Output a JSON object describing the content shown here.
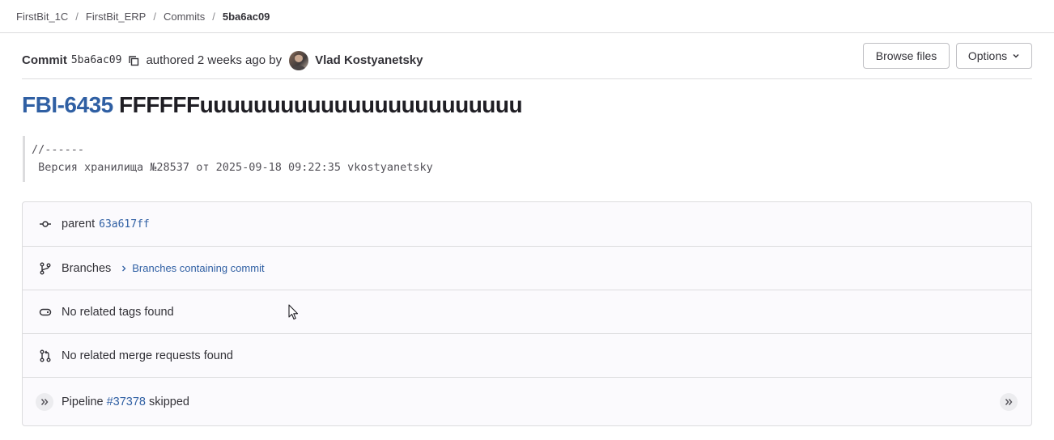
{
  "breadcrumb": {
    "items": [
      "FirstBit_1C",
      "FirstBit_ERP",
      "Commits",
      "5ba6ac09"
    ],
    "separator": "/"
  },
  "header": {
    "commit_label": "Commit",
    "sha": "5ba6ac09",
    "authored_text": "authored 2 weeks ago by",
    "author": "Vlad Kostyanetsky",
    "browse_files_label": "Browse files",
    "options_label": "Options"
  },
  "title": {
    "issue_key": "FBI-6435",
    "text": "FFFFFFuuuuuuuuuuuuuuuuuuuuuuuu"
  },
  "description": {
    "line1": "//------",
    "line2": " Версия хранилища №28537 от 2025-09-18 09:22:35 vkostyanetsky"
  },
  "info": {
    "parent_label": "parent",
    "parent_sha": "63a617ff",
    "branches_label": "Branches",
    "branches_link": "Branches containing commit",
    "tags_text": "No related tags found",
    "merge_requests_text": "No related merge requests found",
    "pipeline_label": "Pipeline",
    "pipeline_id": "#37378",
    "pipeline_status": "skipped"
  },
  "icons": [
    "copy-icon",
    "chevron-down-icon",
    "commit-icon",
    "branch-icon",
    "tag-icon",
    "merge-request-icon",
    "pipeline-skipped-icon",
    "cursor-icon"
  ],
  "colors": {
    "link": "#2f5fa3",
    "border": "#dcdcde",
    "panel_bg": "#fbfafd"
  }
}
